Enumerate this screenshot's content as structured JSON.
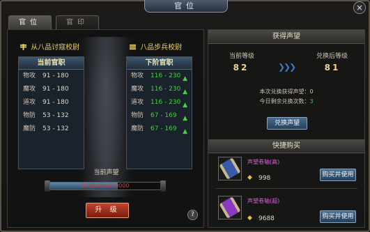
{
  "window": {
    "title": "官位",
    "close_label": "×"
  },
  "tabs": [
    {
      "label": "官位",
      "active": true
    },
    {
      "label": "官印",
      "active": false
    }
  ],
  "left": {
    "current_rank_name": "从八品讨寇校尉",
    "next_rank_name": "八品步兵校尉",
    "current_box_title": "当前官职",
    "next_box_title": "下阶官职",
    "current_stats": [
      {
        "name": "物攻",
        "value": "91 - 180"
      },
      {
        "name": "魔攻",
        "value": "91 - 180"
      },
      {
        "name": "道攻",
        "value": "91 - 180"
      },
      {
        "name": "物防",
        "value": "53 - 132"
      },
      {
        "name": "魔防",
        "value": "53 - 132"
      }
    ],
    "next_stats": [
      {
        "name": "物攻",
        "value": "116 - 230"
      },
      {
        "name": "魔攻",
        "value": "116 - 230"
      },
      {
        "name": "道攻",
        "value": "116 - 230"
      },
      {
        "name": "物防",
        "value": "67 - 169"
      },
      {
        "name": "魔防",
        "value": "67 - 169"
      }
    ],
    "prestige_label": "当前声望",
    "prestige_text": "800000/1300000",
    "prestige_fraction": 0.615,
    "upgrade_label": "升 级",
    "help_label": "?"
  },
  "prestige_section": {
    "title": "获得声望",
    "current_level_label": "当前等级",
    "after_level_label": "兑换后等级",
    "current_level": "82",
    "after_level": "81",
    "gain_line_prefix": "本次兑换获得声望：",
    "gain_value": "0",
    "remaining_line_prefix": "今日剩余兑换次数：",
    "remaining_value": "3",
    "exchange_button": "兑换声望"
  },
  "quick_buy": {
    "title": "快捷购买",
    "items": [
      {
        "name": "声望卷轴(高)",
        "price": "998",
        "button": "购买并使用",
        "name_color": "#e060e0",
        "scroll_color": "#3a5aa8"
      },
      {
        "name": "声望卷轴(超)",
        "price": "9688",
        "button": "购买并使用",
        "name_color": "#e060e0",
        "scroll_color": "#8a3ac0"
      }
    ]
  },
  "colors": {
    "gold": "#f0d060",
    "green_stat": "#45d045",
    "upgrade_red": "#b03020",
    "blue_button": "#3a5a7c"
  }
}
